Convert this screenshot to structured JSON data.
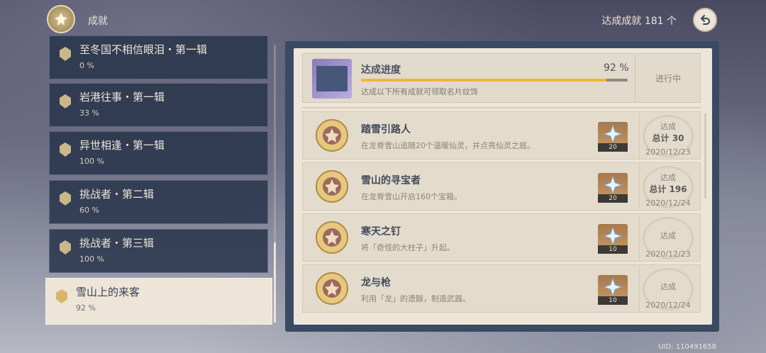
{
  "header": {
    "title": "成就",
    "achieved_count_label": "达成成就 181 个",
    "icons": {
      "emblem": "achievement-emblem-icon",
      "back": "back-arrow-icon"
    }
  },
  "categories": [
    {
      "name": "至冬国不相信眼泪・第一辑",
      "percent": "0 %",
      "active": false
    },
    {
      "name": "岩港往事・第一辑",
      "percent": "33 %",
      "active": false
    },
    {
      "name": "异世相逢・第一辑",
      "percent": "100 %",
      "active": false
    },
    {
      "name": "挑战者・第二辑",
      "percent": "60 %",
      "active": false
    },
    {
      "name": "挑战者・第三辑",
      "percent": "100 %",
      "active": false
    },
    {
      "name": "雪山上的来客",
      "percent": "92 %",
      "active": true
    }
  ],
  "progress": {
    "title": "达成进度",
    "percent_label": "92 %",
    "fraction": 0.92,
    "description": "达成以下所有成就可领取名片纹饰",
    "status": "进行中"
  },
  "achievements": [
    {
      "title": "踏雪引路人",
      "desc": "在龙脊雪山追随20个温暖仙灵，并点亮仙灵之庭。",
      "reward": "20",
      "status": "达成",
      "total": "总计 30",
      "date": "2020/12/23"
    },
    {
      "title": "雪山的寻宝者",
      "desc": "在龙脊雪山开启160个宝箱。",
      "reward": "20",
      "status": "达成",
      "total": "总计 196",
      "date": "2020/12/24"
    },
    {
      "title": "寒天之钉",
      "desc": "将「奇怪的大柱子」升起。",
      "reward": "10",
      "status": "达成",
      "total": "",
      "date": "2020/12/23"
    },
    {
      "title": "龙与枪",
      "desc": "利用「龙」的遗骸，制造武器。",
      "reward": "10",
      "status": "达成",
      "total": "",
      "date": "2020/12/24"
    }
  ],
  "footer": {
    "uid": "UID: 110491658"
  },
  "colors": {
    "accent": "#f3b43a",
    "panel": "#3b4a63",
    "card": "#ece5d8"
  }
}
